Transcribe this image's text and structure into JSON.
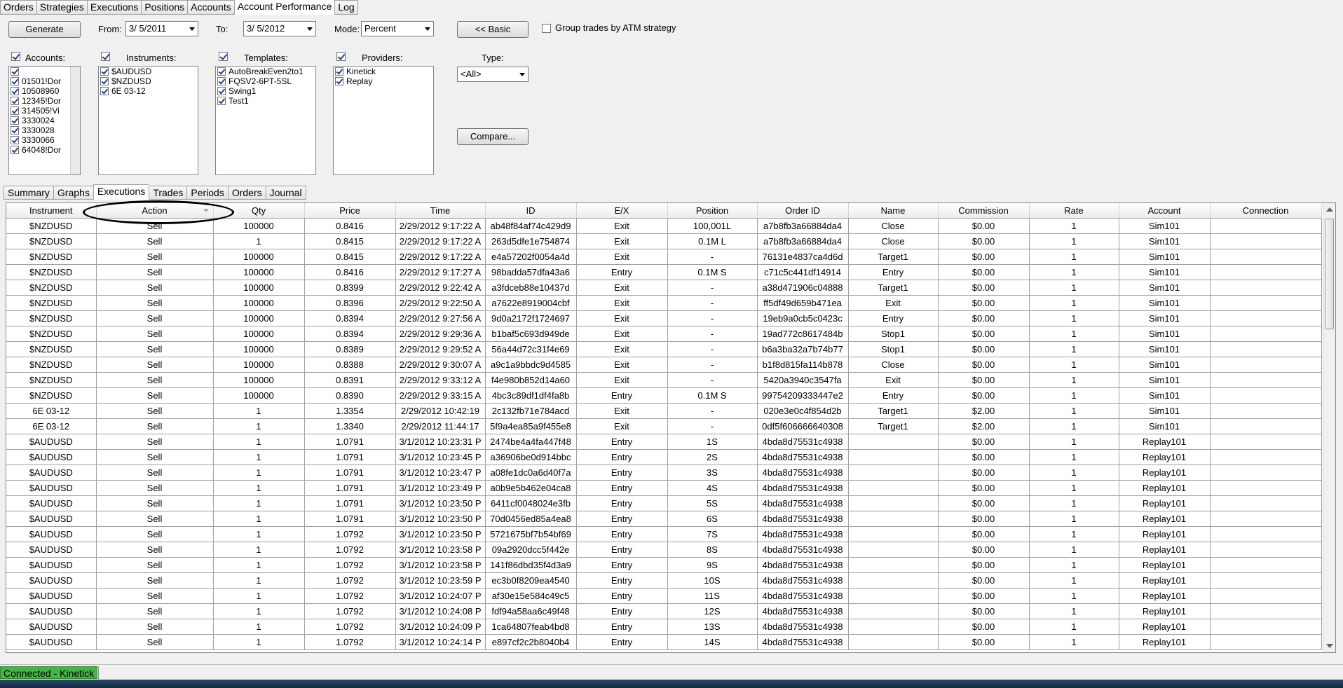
{
  "top_tabs": [
    "Orders",
    "Strategies",
    "Executions",
    "Positions",
    "Accounts",
    "Account Performance",
    "Log"
  ],
  "active_top_tab": "Account Performance",
  "controls": {
    "generate_label": "Generate",
    "from_label": "From:",
    "from_value": "3/  5/2011",
    "to_label": "To:",
    "to_value": "3/  5/2012",
    "mode_label": "Mode:",
    "mode_value": "Percent",
    "basic_label": "<< Basic",
    "group_label": "Group trades by ATM strategy",
    "type_label": "Type:",
    "type_value": "<All>",
    "compare_label": "Compare..."
  },
  "filters": {
    "accounts_label": "Accounts:",
    "accounts": [
      "",
      "01501!Dor",
      "10508960",
      "12345!Dor",
      "314505!Vi",
      "3330024",
      "3330028",
      "3330066",
      "64048!Dor"
    ],
    "instruments_label": "Instruments:",
    "instruments": [
      "$AUDUSD",
      "$NZDUSD",
      "6E 03-12"
    ],
    "templates_label": "Templates:",
    "templates": [
      "AutoBreakEven2to1",
      "FQSV2-6PT-5SL",
      "Swing1",
      "Test1"
    ],
    "providers_label": "Providers:",
    "providers": [
      "Kinetick",
      "Replay"
    ]
  },
  "sub_tabs": [
    "Summary",
    "Graphs",
    "Executions",
    "Trades",
    "Periods",
    "Orders",
    "Journal"
  ],
  "active_sub_tab": "Executions",
  "grid": {
    "columns": [
      "Instrument",
      "Action",
      "Qty",
      "Price",
      "Time",
      "ID",
      "E/X",
      "Position",
      "Order ID",
      "Name",
      "Commission",
      "Rate",
      "Account",
      "Connection"
    ],
    "rows": [
      [
        "$NZDUSD",
        "Sell",
        "100000",
        "0.8416",
        "2/29/2012 9:17:22 A",
        "ab48f84af74c429d9",
        "Exit",
        "100,001L",
        "a7b8fb3a66884da4",
        "Close",
        "$0.00",
        "1",
        "Sim101",
        ""
      ],
      [
        "$NZDUSD",
        "Sell",
        "1",
        "0.8415",
        "2/29/2012 9:17:22 A",
        "263d5dfe1e754874",
        "Exit",
        "0.1M L",
        "a7b8fb3a66884da4",
        "Close",
        "$0.00",
        "1",
        "Sim101",
        ""
      ],
      [
        "$NZDUSD",
        "Sell",
        "100000",
        "0.8415",
        "2/29/2012 9:17:22 A",
        "e4a57202f0054a4d",
        "Exit",
        "-",
        "76131e4837ca4d6d",
        "Target1",
        "$0.00",
        "1",
        "Sim101",
        ""
      ],
      [
        "$NZDUSD",
        "Sell",
        "100000",
        "0.8416",
        "2/29/2012 9:17:27 A",
        "98badda57dfa43a6",
        "Entry",
        "0.1M S",
        "c71c5c441df14914",
        "Entry",
        "$0.00",
        "1",
        "Sim101",
        ""
      ],
      [
        "$NZDUSD",
        "Sell",
        "100000",
        "0.8399",
        "2/29/2012 9:22:42 A",
        "a3fdceb88e10437d",
        "Exit",
        "-",
        "a38d471906c04888",
        "Target1",
        "$0.00",
        "1",
        "Sim101",
        ""
      ],
      [
        "$NZDUSD",
        "Sell",
        "100000",
        "0.8396",
        "2/29/2012 9:22:50 A",
        "a7622e8919004cbf",
        "Exit",
        "-",
        "ff5df49d659b471ea",
        "Exit",
        "$0.00",
        "1",
        "Sim101",
        ""
      ],
      [
        "$NZDUSD",
        "Sell",
        "100000",
        "0.8394",
        "2/29/2012 9:27:56 A",
        "9d0a2172f1724697",
        "Exit",
        "-",
        "19eb9a0cb5c0423c",
        "Entry",
        "$0.00",
        "1",
        "Sim101",
        ""
      ],
      [
        "$NZDUSD",
        "Sell",
        "100000",
        "0.8394",
        "2/29/2012 9:29:36 A",
        "b1baf5c693d949de",
        "Exit",
        "-",
        "19ad772c8617484b",
        "Stop1",
        "$0.00",
        "1",
        "Sim101",
        ""
      ],
      [
        "$NZDUSD",
        "Sell",
        "100000",
        "0.8389",
        "2/29/2012 9:29:52 A",
        "56a44d72c31f4e69",
        "Exit",
        "-",
        "b6a3ba32a7b74b77",
        "Stop1",
        "$0.00",
        "1",
        "Sim101",
        ""
      ],
      [
        "$NZDUSD",
        "Sell",
        "100000",
        "0.8388",
        "2/29/2012 9:30:07 A",
        "a9c1a9bbdc9d4585",
        "Exit",
        "-",
        "b1f8d815fa114b878",
        "Close",
        "$0.00",
        "1",
        "Sim101",
        ""
      ],
      [
        "$NZDUSD",
        "Sell",
        "100000",
        "0.8391",
        "2/29/2012 9:33:12 A",
        "f4e980b852d14a60",
        "Exit",
        "-",
        "5420a3940c3547fa",
        "Exit",
        "$0.00",
        "1",
        "Sim101",
        ""
      ],
      [
        "$NZDUSD",
        "Sell",
        "100000",
        "0.8390",
        "2/29/2012 9:33:15 A",
        "4bc3c89df1df4fa8b",
        "Entry",
        "0.1M S",
        "99754209333447e2",
        "Entry",
        "$0.00",
        "1",
        "Sim101",
        ""
      ],
      [
        "6E 03-12",
        "Sell",
        "1",
        "1.3354",
        "2/29/2012 10:42:19",
        "2c132fb71e784acd",
        "Exit",
        "-",
        "020e3e0c4f854d2b",
        "Target1",
        "$2.00",
        "1",
        "Sim101",
        ""
      ],
      [
        "6E 03-12",
        "Sell",
        "1",
        "1.3340",
        "2/29/2012 11:44:17",
        "5f9a4ea85a9f455e8",
        "Exit",
        "-",
        "0df5f606666640308",
        "Target1",
        "$2.00",
        "1",
        "Sim101",
        ""
      ],
      [
        "$AUDUSD",
        "Sell",
        "1",
        "1.0791",
        "3/1/2012 10:23:31 P",
        "2474be4a4fa447f48",
        "Entry",
        "1S",
        "4bda8d75531c4938",
        "",
        "$0.00",
        "1",
        "Replay101",
        ""
      ],
      [
        "$AUDUSD",
        "Sell",
        "1",
        "1.0791",
        "3/1/2012 10:23:45 P",
        "a36906be0d914bbc",
        "Entry",
        "2S",
        "4bda8d75531c4938",
        "",
        "$0.00",
        "1",
        "Replay101",
        ""
      ],
      [
        "$AUDUSD",
        "Sell",
        "1",
        "1.0791",
        "3/1/2012 10:23:47 P",
        "a08fe1dc0a6d40f7a",
        "Entry",
        "3S",
        "4bda8d75531c4938",
        "",
        "$0.00",
        "1",
        "Replay101",
        ""
      ],
      [
        "$AUDUSD",
        "Sell",
        "1",
        "1.0791",
        "3/1/2012 10:23:49 P",
        "a0b9e5b462e04ca8",
        "Entry",
        "4S",
        "4bda8d75531c4938",
        "",
        "$0.00",
        "1",
        "Replay101",
        ""
      ],
      [
        "$AUDUSD",
        "Sell",
        "1",
        "1.0791",
        "3/1/2012 10:23:50 P",
        "6411cf0048024e3fb",
        "Entry",
        "5S",
        "4bda8d75531c4938",
        "",
        "$0.00",
        "1",
        "Replay101",
        ""
      ],
      [
        "$AUDUSD",
        "Sell",
        "1",
        "1.0791",
        "3/1/2012 10:23:50 P",
        "70d0456ed85a4ea8",
        "Entry",
        "6S",
        "4bda8d75531c4938",
        "",
        "$0.00",
        "1",
        "Replay101",
        ""
      ],
      [
        "$AUDUSD",
        "Sell",
        "1",
        "1.0792",
        "3/1/2012 10:23:50 P",
        "5721675bf7b54bf69",
        "Entry",
        "7S",
        "4bda8d75531c4938",
        "",
        "$0.00",
        "1",
        "Replay101",
        ""
      ],
      [
        "$AUDUSD",
        "Sell",
        "1",
        "1.0792",
        "3/1/2012 10:23:58 P",
        "09a2920dcc5f442e",
        "Entry",
        "8S",
        "4bda8d75531c4938",
        "",
        "$0.00",
        "1",
        "Replay101",
        ""
      ],
      [
        "$AUDUSD",
        "Sell",
        "1",
        "1.0792",
        "3/1/2012 10:23:58 P",
        "141f86dbd35f4d3a9",
        "Entry",
        "9S",
        "4bda8d75531c4938",
        "",
        "$0.00",
        "1",
        "Replay101",
        ""
      ],
      [
        "$AUDUSD",
        "Sell",
        "1",
        "1.0792",
        "3/1/2012 10:23:59 P",
        "ec3b0f8209ea4540",
        "Entry",
        "10S",
        "4bda8d75531c4938",
        "",
        "$0.00",
        "1",
        "Replay101",
        ""
      ],
      [
        "$AUDUSD",
        "Sell",
        "1",
        "1.0792",
        "3/1/2012 10:24:07 P",
        "af30e15e584c49c5",
        "Entry",
        "11S",
        "4bda8d75531c4938",
        "",
        "$0.00",
        "1",
        "Replay101",
        ""
      ],
      [
        "$AUDUSD",
        "Sell",
        "1",
        "1.0792",
        "3/1/2012 10:24:08 P",
        "fdf94a58aa6c49f48",
        "Entry",
        "12S",
        "4bda8d75531c4938",
        "",
        "$0.00",
        "1",
        "Replay101",
        ""
      ],
      [
        "$AUDUSD",
        "Sell",
        "1",
        "1.0792",
        "3/1/2012 10:24:09 P",
        "1ca64807feab4bd8",
        "Entry",
        "13S",
        "4bda8d75531c4938",
        "",
        "$0.00",
        "1",
        "Replay101",
        ""
      ],
      [
        "$AUDUSD",
        "Sell",
        "1",
        "1.0792",
        "3/1/2012 10:24:14 P",
        "e897cf2c2b8040b4",
        "Entry",
        "14S",
        "4bda8d75531c4938",
        "",
        "$0.00",
        "1",
        "Replay101",
        ""
      ]
    ]
  },
  "status": {
    "connection": "Connected - Kinetick"
  }
}
